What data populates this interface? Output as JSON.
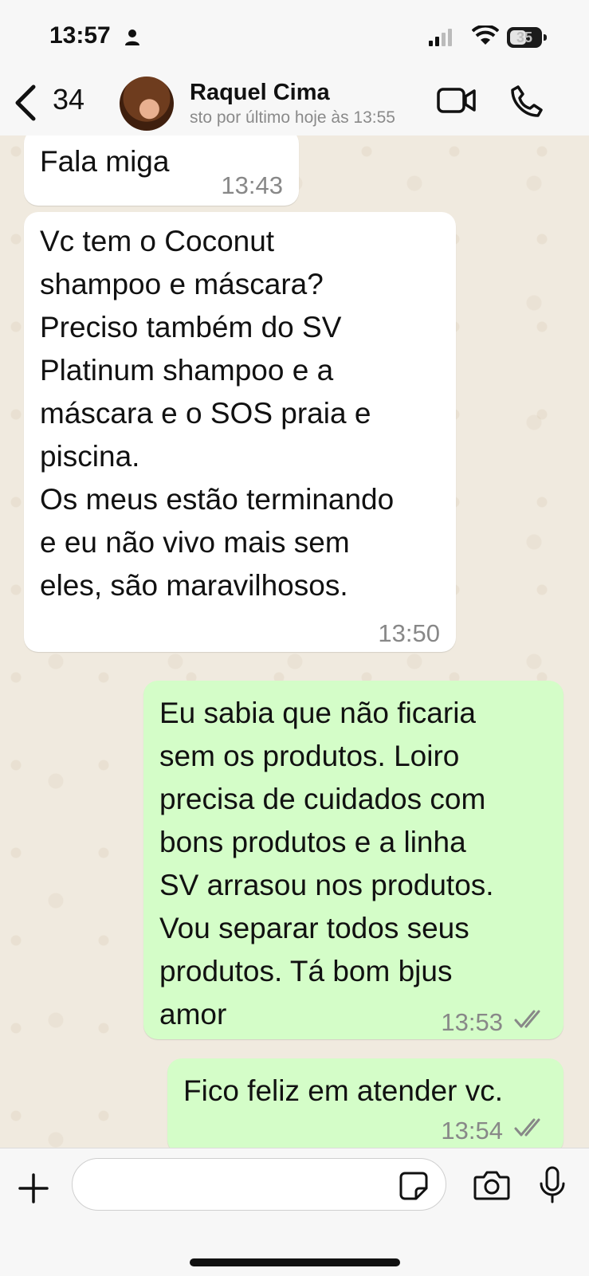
{
  "status_bar": {
    "time": "13:57",
    "battery": "35",
    "icons": [
      "person-icon",
      "signal-icon",
      "wifi-icon",
      "battery-icon"
    ]
  },
  "header": {
    "back_count": "34",
    "contact_name": "Raquel Cima",
    "last_seen": "sto por último hoje às 13:55",
    "icons": [
      "chevron-left-icon",
      "video-call-icon",
      "phone-icon"
    ]
  },
  "messages": [
    {
      "direction": "incoming",
      "text": "Fala miga",
      "time": "13:43"
    },
    {
      "direction": "incoming",
      "text": "Vc tem o Coconut\nshampoo e máscara?\nPreciso também do SV\nPlatinum shampoo e a\nmáscara e o SOS praia e\npiscina.\nOs meus estão terminando\ne eu não vivo mais sem\neles, são maravilhosos.",
      "time": "13:50"
    },
    {
      "direction": "outgoing",
      "text": "Eu sabia que não ficaria\nsem os produtos. Loiro\nprecisa de cuidados com\nbons produtos  e a linha\nSV arrasou nos produtos.\nVou separar todos seus\nprodutos. Tá bom bjus\namor",
      "time": "13:53",
      "status": "read"
    },
    {
      "direction": "outgoing",
      "text": "Fico feliz  em atender vc.",
      "time": "13:54",
      "status": "read"
    }
  ],
  "input_bar": {
    "placeholder": "",
    "icons": [
      "plus-icon",
      "sticker-icon",
      "camera-icon",
      "microphone-icon"
    ]
  },
  "colors": {
    "incoming_bubble": "#ffffff",
    "outgoing_bubble": "#d4fdc8",
    "chat_background": "#f0eadf",
    "read_ticks": "#888888"
  }
}
